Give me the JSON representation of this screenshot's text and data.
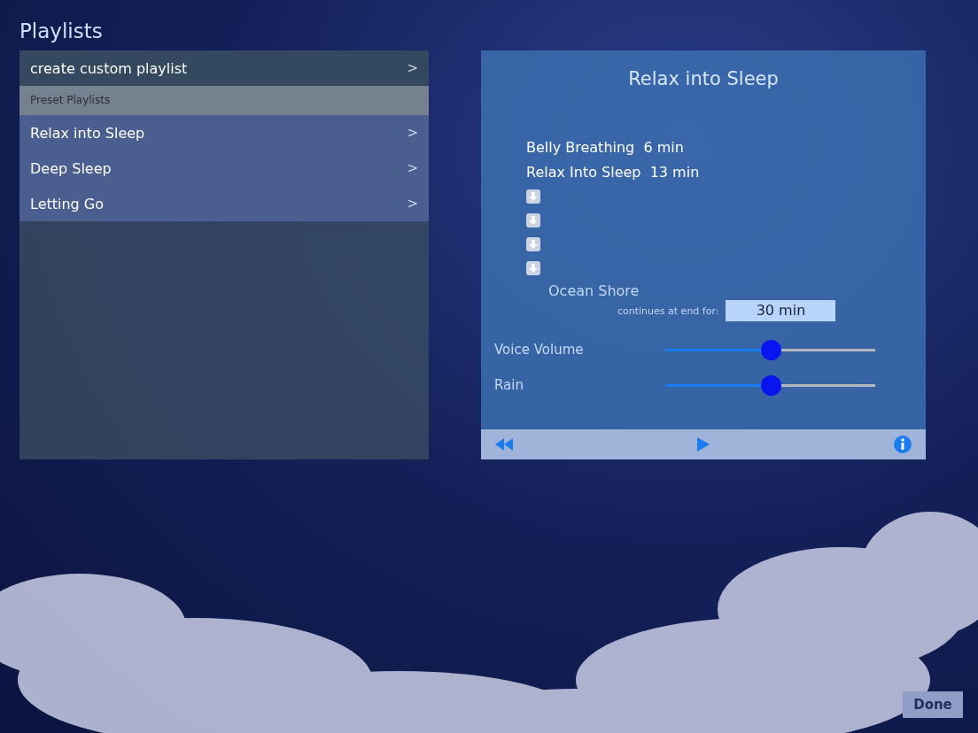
{
  "title": "Playlists",
  "create_row": {
    "label": "create custom playlist",
    "chevron": ">"
  },
  "section_header": "Preset Playlists",
  "playlists": [
    {
      "label": "Relax into Sleep",
      "chevron": ">"
    },
    {
      "label": "Deep Sleep",
      "chevron": ">"
    },
    {
      "label": "Letting Go",
      "chevron": ">"
    }
  ],
  "detail": {
    "title": "Relax into Sleep",
    "items": [
      {
        "kind": "track",
        "text": "Belly Breathing  6 min"
      },
      {
        "kind": "track",
        "text": "Relax Into Sleep  13 min"
      },
      {
        "kind": "download"
      },
      {
        "kind": "download"
      },
      {
        "kind": "download"
      },
      {
        "kind": "download"
      }
    ],
    "ambient": {
      "name": "Ocean Shore",
      "continues_label": "continues at end for:",
      "duration": "30 min"
    },
    "sliders": [
      {
        "label": "Voice Volume",
        "level": 0.5
      },
      {
        "label": "Rain",
        "level": 0.5
      }
    ]
  },
  "done_button": "Done"
}
